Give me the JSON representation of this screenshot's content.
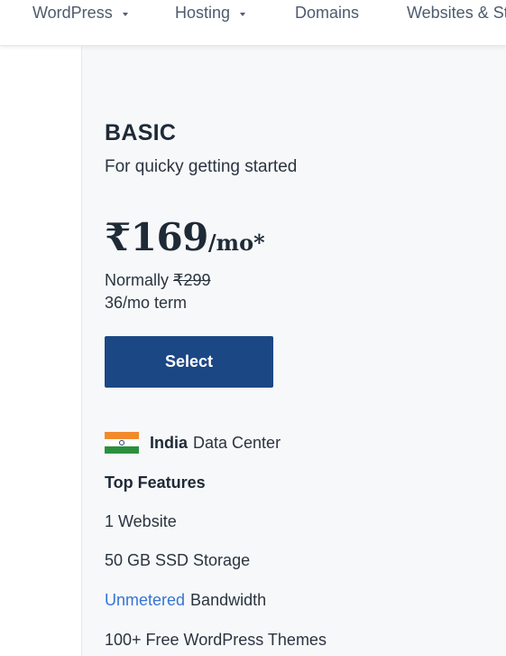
{
  "nav": {
    "items": [
      {
        "label": "WordPress",
        "has_dropdown": true
      },
      {
        "label": "Hosting",
        "has_dropdown": true
      },
      {
        "label": "Domains",
        "has_dropdown": false
      },
      {
        "label": "Websites & St",
        "has_dropdown": false
      }
    ]
  },
  "plan": {
    "name": "BASIC",
    "tagline": "For quicky getting started",
    "price": "₹169",
    "price_suffix": "/mo*",
    "normally_label": "Normally",
    "normal_price": "₹299",
    "term": "36/mo term",
    "select_label": "Select",
    "datacenter": {
      "country": "India",
      "label": "Data Center",
      "flag_icon": "india-flag-icon"
    },
    "features_title": "Top Features",
    "features": {
      "websites": "1 Website",
      "storage": "50 GB SSD Storage",
      "bandwidth_link": "Unmetered",
      "bandwidth_label": "Bandwidth",
      "themes": "100+ Free WordPress Themes"
    }
  },
  "colors": {
    "accent": "#1b4785",
    "link": "#3575d3",
    "panel_bg": "#f7f8f9"
  }
}
